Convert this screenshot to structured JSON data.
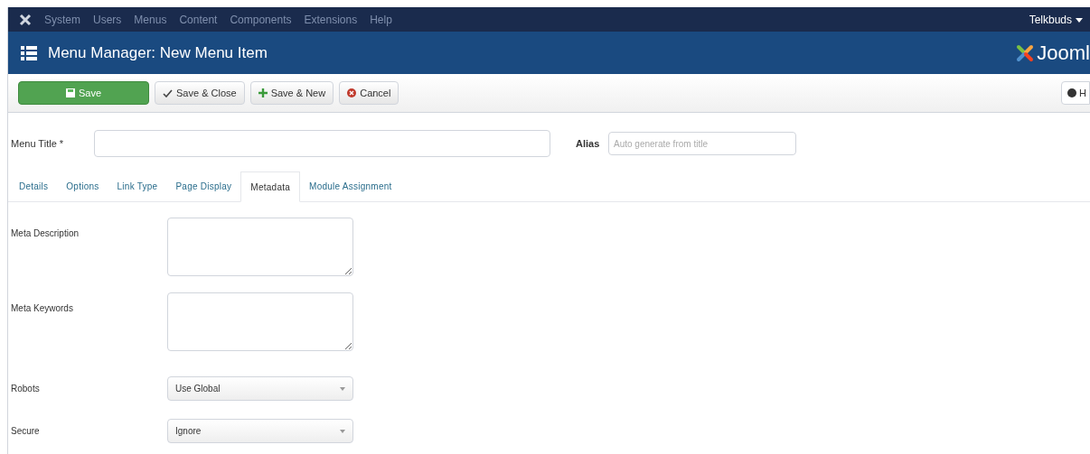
{
  "nav_menu": [
    "System",
    "Users",
    "Menus",
    "Content",
    "Components",
    "Extensions",
    "Help"
  ],
  "user": "Telkbuds",
  "header": {
    "title": "Menu Manager: New Menu Item",
    "logo_text": "Jooml"
  },
  "toolbar": [
    {
      "label": "Save",
      "kind": "save"
    },
    {
      "label": "Save & Close",
      "kind": "save-close"
    },
    {
      "label": "Save & New",
      "kind": "save-new"
    },
    {
      "label": "Cancel",
      "kind": "cancel"
    }
  ],
  "help_button": "H",
  "menu_title": {
    "label": "Menu Title",
    "required_mark": "*"
  },
  "alias": {
    "label": "Alias",
    "placeholder": "Auto generate from title"
  },
  "tabs": [
    {
      "label": "Details",
      "selected": false
    },
    {
      "label": "Options",
      "selected": false
    },
    {
      "label": "Link Type",
      "selected": false
    },
    {
      "label": "Page Display",
      "selected": false
    },
    {
      "label": "Metadata",
      "selected": true
    },
    {
      "label": "Module Assignment",
      "selected": false
    }
  ],
  "fields": [
    {
      "label": "Meta Description",
      "kind": "textarea"
    },
    {
      "label": "Meta Keywords",
      "kind": "textarea"
    },
    {
      "label": "Robots",
      "kind": "select",
      "value": "Use Global"
    },
    {
      "label": "Secure",
      "kind": "select",
      "value": "Ignore"
    }
  ]
}
